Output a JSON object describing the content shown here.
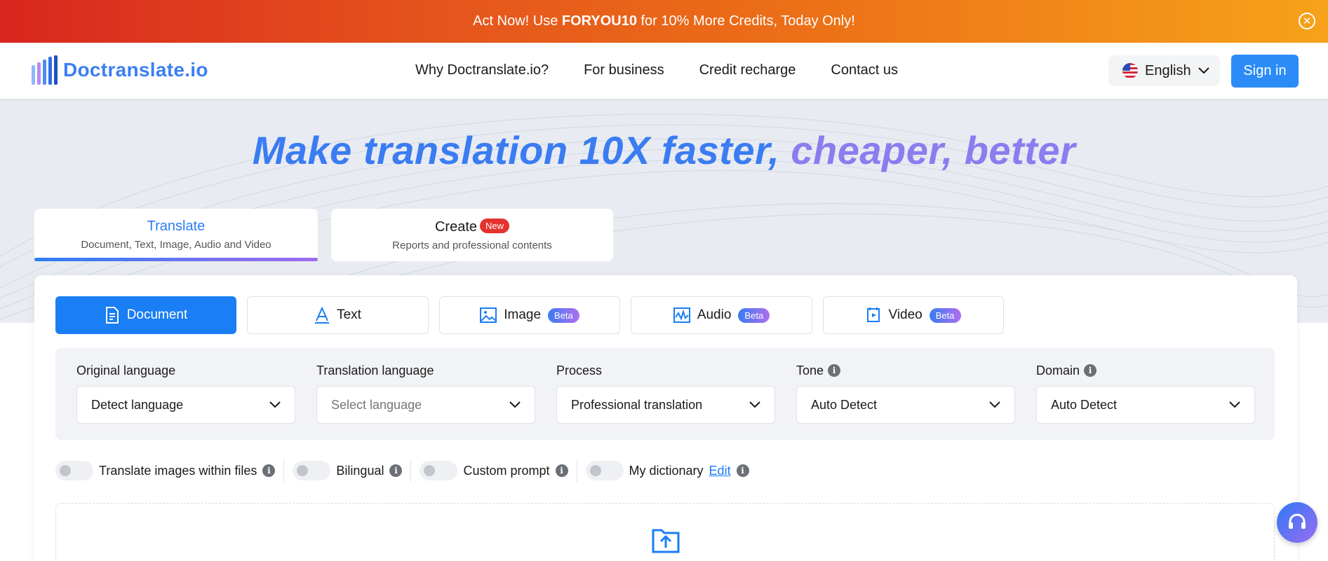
{
  "promo": {
    "prefix": "Act Now! Use ",
    "code": "FORYOU10",
    "suffix": " for 10% More Credits, Today Only!",
    "close_icon": "close-circle-icon"
  },
  "nav": {
    "logo_text": "Doctranslate.io",
    "links": [
      "Why Doctranslate.io?",
      "For business",
      "Credit recharge",
      "Contact us"
    ],
    "language": "English",
    "sign_in": "Sign in"
  },
  "hero": {
    "headline_part1": "Make translation 10X faster, ",
    "headline_part2": "cheaper, better"
  },
  "mode_tabs": [
    {
      "title": "Translate",
      "subtitle": "Document, Text, Image, Audio and Video",
      "active": true
    },
    {
      "title": "Create",
      "badge": "New",
      "subtitle": "Reports and professional contents",
      "active": false
    }
  ],
  "type_buttons": [
    {
      "label": "Document",
      "icon": "document-icon",
      "active": true
    },
    {
      "label": "Text",
      "icon": "text-icon"
    },
    {
      "label": "Image",
      "icon": "image-icon",
      "badge": "Beta"
    },
    {
      "label": "Audio",
      "icon": "audio-icon",
      "badge": "Beta"
    },
    {
      "label": "Video",
      "icon": "video-icon",
      "badge": "Beta"
    }
  ],
  "settings": {
    "original_language": {
      "label": "Original language",
      "value": "Detect language"
    },
    "translation_language": {
      "label": "Translation language",
      "placeholder": "Select language"
    },
    "process": {
      "label": "Process",
      "value": "Professional translation"
    },
    "tone": {
      "label": "Tone",
      "value": "Auto Detect"
    },
    "domain": {
      "label": "Domain",
      "value": "Auto Detect"
    }
  },
  "toggles": {
    "translate_images": "Translate images within files",
    "bilingual": "Bilingual",
    "custom_prompt": "Custom prompt",
    "my_dictionary": "My dictionary",
    "edit": "Edit"
  },
  "colors": {
    "primary": "#1a7ef5",
    "accent_purple": "#8d7bf0",
    "promo_start": "#d9261f",
    "promo_end": "#f7a21a"
  }
}
